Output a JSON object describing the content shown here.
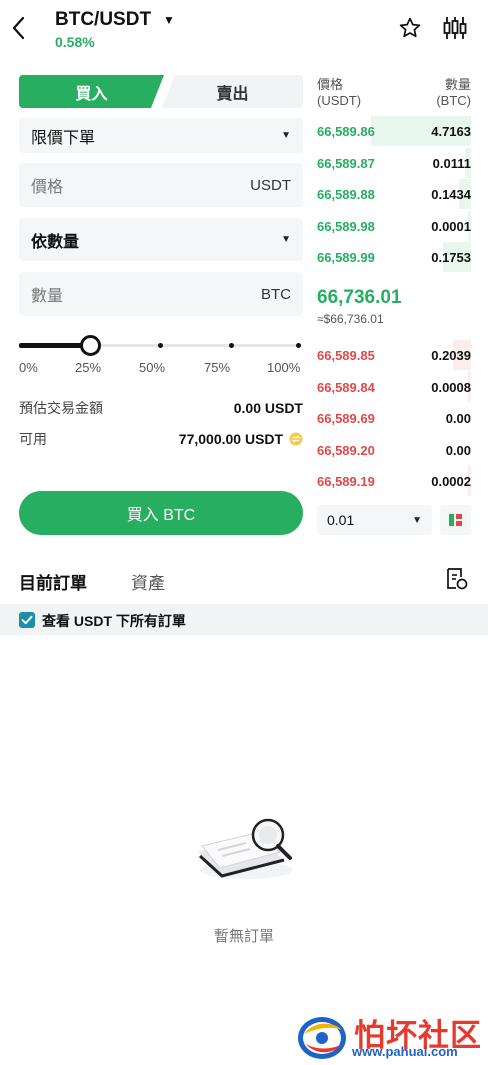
{
  "header": {
    "pair": "BTC/USDT",
    "change": "0.58%"
  },
  "trade_tabs": {
    "buy": "買入",
    "sell": "賣出"
  },
  "order_type": {
    "value": "限價下單"
  },
  "price_field": {
    "label": "價格",
    "unit": "USDT"
  },
  "amount_mode": {
    "value": "依數量"
  },
  "amount_field": {
    "label": "數量",
    "unit": "BTC"
  },
  "slider": {
    "value_fraction": 0.25,
    "labels": [
      "0%",
      "25%",
      "50%",
      "75%",
      "100%"
    ]
  },
  "estimate": {
    "label": "預估交易金額",
    "value": "0.00",
    "unit": "USDT"
  },
  "available": {
    "label": "可用",
    "value": "77,000.00",
    "unit": "USDT"
  },
  "buy_button": {
    "label": "買入 BTC"
  },
  "orderbook": {
    "price_header": "價格",
    "price_unit": "(USDT)",
    "qty_header": "數量",
    "qty_unit": "(BTC)",
    "bids": [
      {
        "price": "66,589.86",
        "qty": "4.7163",
        "depth": 0.65
      },
      {
        "price": "66,589.87",
        "qty": "0.0111",
        "depth": 0.04
      },
      {
        "price": "66,589.88",
        "qty": "0.1434",
        "depth": 0.08
      },
      {
        "price": "66,589.98",
        "qty": "0.0001",
        "depth": 0.02
      },
      {
        "price": "66,589.99",
        "qty": "0.1753",
        "depth": 0.18
      }
    ],
    "mid_price": "66,736.01",
    "mid_usd": "≈$66,736.01",
    "asks": [
      {
        "price": "66,589.85",
        "qty": "0.2039",
        "depth": 0.12
      },
      {
        "price": "66,589.84",
        "qty": "0.0008",
        "depth": 0.02
      },
      {
        "price": "66,589.69",
        "qty": "0.00",
        "depth": 0
      },
      {
        "price": "66,589.20",
        "qty": "0.00",
        "depth": 0
      },
      {
        "price": "66,589.19",
        "qty": "0.0002",
        "depth": 0.02
      }
    ],
    "depth_select": "0.01"
  },
  "orders": {
    "tab_current": "目前訂單",
    "tab_assets": "資產",
    "filter_label": "查看 USDT 下所有訂單",
    "empty_text": "暫無訂單"
  },
  "watermark": {
    "title": "怕坏社区",
    "url": "www.pahuai.com"
  },
  "colors": {
    "buy": "#27ae60",
    "sell": "#e04848"
  }
}
